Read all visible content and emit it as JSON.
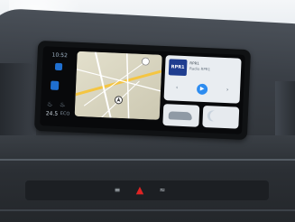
{
  "status": {
    "time": "10:52",
    "temperature": "24.5",
    "eco": "ECO"
  },
  "media": {
    "station_logo": "RPR1",
    "line1": "RPR1",
    "line2": "Radio RPR1"
  },
  "colors": {
    "accent": "#2d8cf0",
    "hazard": "#e02424",
    "station": "#1f3d8f"
  },
  "icons": {
    "prev": "chevron-left-icon",
    "play": "play-icon",
    "next": "chevron-right-icon",
    "car": "car-icon",
    "night_mode": "moon-icon",
    "hazard": "hazard-triangle-icon"
  }
}
